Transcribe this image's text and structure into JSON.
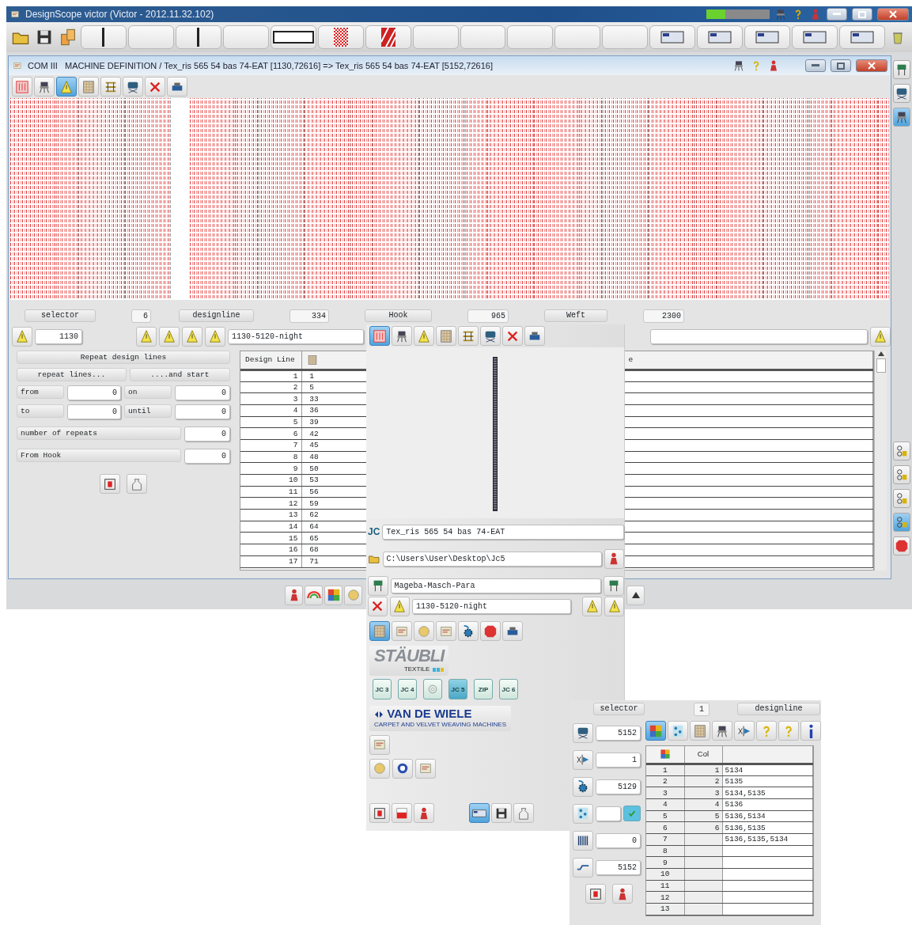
{
  "app": {
    "title": "DesignScope victor (Victor - 2012.11.32.102)"
  },
  "child_window": {
    "title_prefix": "COM III",
    "title": "MACHINE DEFINITION  / Tex_ris 565 54 bas 74-EAT [1130,72616] => Tex_ris 565 54 bas 74-EAT [5152,72616]"
  },
  "tool_tabs": [
    {
      "selected": false
    },
    {
      "selected": false
    },
    {
      "selected": true
    },
    {
      "selected": false
    },
    {
      "selected": false
    },
    {
      "selected": false
    },
    {
      "selected": false
    },
    {
      "selected": false
    }
  ],
  "readouts": [
    {
      "label": "selector",
      "value": "6"
    },
    {
      "label": "designline",
      "value": "334"
    },
    {
      "label": "Hook",
      "value": "965"
    },
    {
      "label": "Weft",
      "value": "2300"
    }
  ],
  "selector_field": "1130",
  "config_field": "1130-5120-night",
  "repeat": {
    "title": "Repeat design lines",
    "col_a": "repeat lines...",
    "col_b": "....and start",
    "pairs": [
      {
        "label": "from",
        "value": "0",
        "label2": "on",
        "value2": "0"
      },
      {
        "label": "to",
        "value": "0",
        "label2": "until",
        "value2": "0"
      }
    ],
    "singles": [
      {
        "label": "number of repeats",
        "value": "0"
      },
      {
        "label": "From Hook",
        "value": "0"
      }
    ]
  },
  "table": {
    "columns": {
      "design_line": "Design Line",
      "column_3": "e"
    },
    "rows": [
      [
        "1",
        "1"
      ],
      [
        "2",
        "5"
      ],
      [
        "3",
        "33"
      ],
      [
        "4",
        "36"
      ],
      [
        "5",
        "39"
      ],
      [
        "6",
        "42"
      ],
      [
        "7",
        "45"
      ],
      [
        "8",
        "48"
      ],
      [
        "9",
        "50"
      ],
      [
        "10",
        "53"
      ],
      [
        "11",
        "56"
      ],
      [
        "12",
        "59"
      ],
      [
        "13",
        "62"
      ],
      [
        "14",
        "64"
      ],
      [
        "15",
        "65"
      ],
      [
        "16",
        "68"
      ],
      [
        "17",
        "71"
      ]
    ]
  },
  "machine_panel": {
    "tabs": [
      {
        "selected": true
      },
      {
        "selected": false
      },
      {
        "selected": false
      },
      {
        "selected": false
      },
      {
        "selected": false
      },
      {
        "selected": false
      },
      {
        "selected": false
      },
      {
        "selected": false
      }
    ],
    "jc_label": "JC",
    "pattern_name": "Tex_ris 565 54 bas 74-EAT",
    "path": "C:\\Users\\User\\Desktop\\Jc5",
    "parameter_set": "Mageba-Masch-Para",
    "config": "1130-5120-night",
    "vendor_tabs": [
      {
        "selected": true
      },
      {
        "selected": false
      },
      {
        "selected": false
      },
      {
        "selected": false
      },
      {
        "selected": false
      },
      {
        "selected": false
      },
      {
        "selected": false
      }
    ],
    "staubli": {
      "name": "STÄUBLI",
      "tagline": "TEXTILE"
    },
    "jc_buttons": [
      {
        "kind": "label",
        "label": "JC 3",
        "selected": false
      },
      {
        "kind": "label",
        "label": "JC 4",
        "selected": false
      },
      {
        "kind": "icon",
        "selected": false
      },
      {
        "kind": "label",
        "label": "JC 5",
        "selected": true
      },
      {
        "kind": "label",
        "label": "ZIP",
        "selected": false
      },
      {
        "kind": "label",
        "label": "JC 6",
        "selected": false
      }
    ],
    "van_de_wiele": {
      "name": "VAN DE WIELE",
      "tagline": "CARPET AND VELVET WEAVING MACHINES"
    },
    "bottom_tabs": [
      {
        "selected": false
      },
      {
        "selected": false
      },
      {
        "selected": false
      },
      {
        "selected": true
      },
      {
        "selected": false
      },
      {
        "selected": false
      }
    ]
  },
  "color_panel": {
    "readouts": [
      {
        "label": "selector",
        "value": "1"
      },
      {
        "label": "designline"
      }
    ],
    "fields": [
      {
        "kind": "number",
        "value": "5152"
      },
      {
        "kind": "number",
        "value": "1"
      },
      {
        "kind": "number",
        "value": "5129"
      },
      {
        "kind": "toggle",
        "checked": true
      },
      {
        "kind": "number",
        "value": "0"
      },
      {
        "kind": "number",
        "value": "5152"
      }
    ],
    "tabs": [
      {
        "selected": true
      },
      {
        "selected": false
      },
      {
        "selected": false
      },
      {
        "selected": false
      },
      {
        "selected": false
      },
      {
        "selected": false
      },
      {
        "selected": false
      },
      {
        "selected": false
      }
    ],
    "table": {
      "columns": {
        "column_2": "Col"
      },
      "rows": [
        {
          "n": "1",
          "col": "1",
          "colors": "5134"
        },
        {
          "n": "2",
          "col": "2",
          "colors": "5135"
        },
        {
          "n": "3",
          "col": "3",
          "colors": "5134,5135"
        },
        {
          "n": "4",
          "col": "4",
          "colors": "5136"
        },
        {
          "n": "5",
          "col": "5",
          "colors": "5136,5134"
        },
        {
          "n": "6",
          "col": "6",
          "colors": "5136,5135"
        },
        {
          "n": "7",
          "colors": "5136,5135,5134"
        },
        {
          "n": "8"
        },
        {
          "n": "9"
        },
        {
          "n": "10"
        },
        {
          "n": "11"
        },
        {
          "n": "12"
        },
        {
          "n": "13"
        }
      ]
    }
  }
}
